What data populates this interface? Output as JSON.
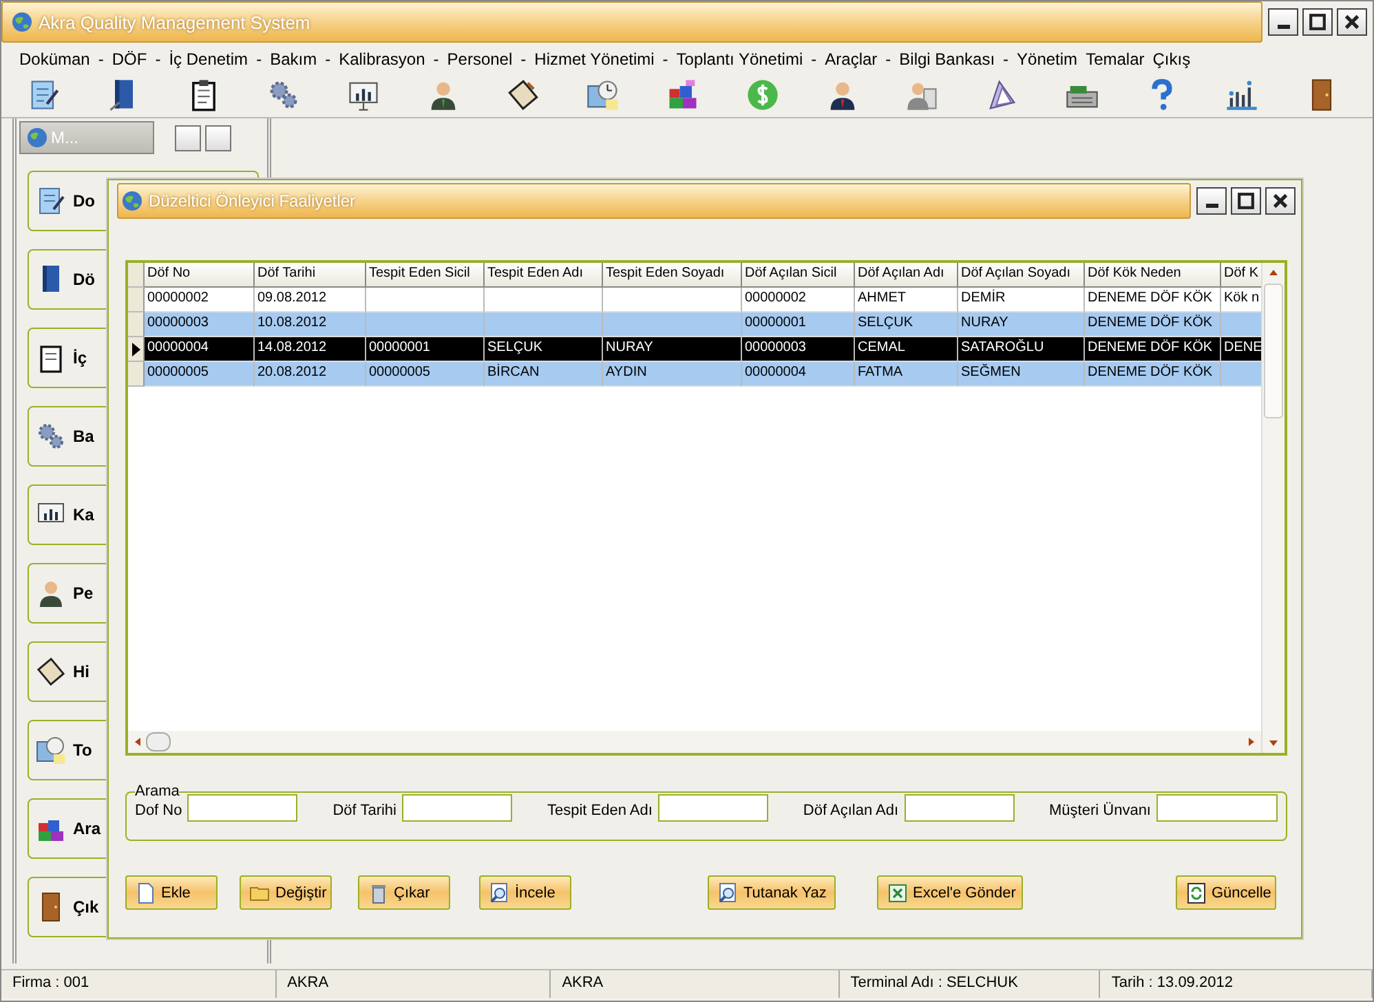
{
  "window": {
    "title": "Akra Quality Management System"
  },
  "menu": [
    "Doküman",
    "-",
    "DÖF",
    "-",
    "İç Denetim",
    "-",
    "Bakım",
    "-",
    "Kalibrasyon",
    "-",
    "Personel",
    "-",
    "Hizmet Yönetimi",
    "-",
    "Toplantı Yönetimi",
    "-",
    "Araçlar",
    "-",
    "Bilgi Bankası",
    "-",
    "Yönetim",
    "Temalar",
    "Çıkış"
  ],
  "side_panel": {
    "title": "M...",
    "buttons": [
      "Do",
      "Dö",
      "İç",
      "Ba",
      "Ka",
      "Pe",
      "Hi",
      "To",
      "Ara",
      "Çık"
    ]
  },
  "dialog": {
    "title": "Düzeltici Önleyici Faaliyetler",
    "table": {
      "columns": [
        "Döf No",
        "Döf Tarihi",
        "Tespit Eden Sicil",
        "Tespit Eden Adı",
        "Tespit Eden Soyadı",
        "Döf Açılan Sicil",
        "Döf Açılan Adı",
        "Döf Açılan Soyadı",
        "Döf Kök Neden",
        "Döf K"
      ],
      "rows": [
        {
          "selected": false,
          "cells": [
            "00000002",
            "09.08.2012",
            "",
            "",
            "",
            "00000002",
            "AHMET",
            "DEMİR",
            "DENEME DÖF KÖK",
            "Kök n"
          ]
        },
        {
          "selected": false,
          "cells": [
            "00000003",
            "10.08.2012",
            "",
            "",
            "",
            "00000001",
            "SELÇUK",
            "NURAY",
            "DENEME DÖF KÖK",
            ""
          ]
        },
        {
          "selected": true,
          "cells": [
            "00000004",
            "14.08.2012",
            "00000001",
            "SELÇUK",
            "NURAY",
            "00000003",
            "CEMAL",
            "SATAROĞLU",
            "DENEME DÖF KÖK",
            "DENE"
          ]
        },
        {
          "selected": false,
          "cells": [
            "00000005",
            "20.08.2012",
            "00000005",
            "BİRCAN",
            "AYDIN",
            "00000004",
            "FATMA",
            "SEĞMEN",
            "DENEME DÖF KÖK",
            ""
          ]
        }
      ]
    },
    "search": {
      "title": "Arama",
      "fields": [
        {
          "label": "Dof No"
        },
        {
          "label": "Döf Tarihi"
        },
        {
          "label": "Tespit Eden Adı"
        },
        {
          "label": "Döf Açılan Adı"
        },
        {
          "label": "Müşteri Ünvanı"
        }
      ]
    },
    "buttons": [
      {
        "label": "Ekle",
        "kind": "new"
      },
      {
        "label": "Değiştir",
        "kind": "open"
      },
      {
        "label": "Çıkar",
        "kind": "delete"
      },
      {
        "label": "İncele",
        "kind": "view"
      },
      {
        "label": "Tutanak Yaz",
        "kind": "view"
      },
      {
        "label": "Excel'e Gönder",
        "kind": "excel"
      },
      {
        "label": "Güncelle",
        "kind": "refresh"
      }
    ]
  },
  "status_bar": [
    "Firma : 001",
    "AKRA",
    "AKRA",
    "Terminal Adı : SELCHUK",
    "Tarih : 13.09.2012"
  ]
}
